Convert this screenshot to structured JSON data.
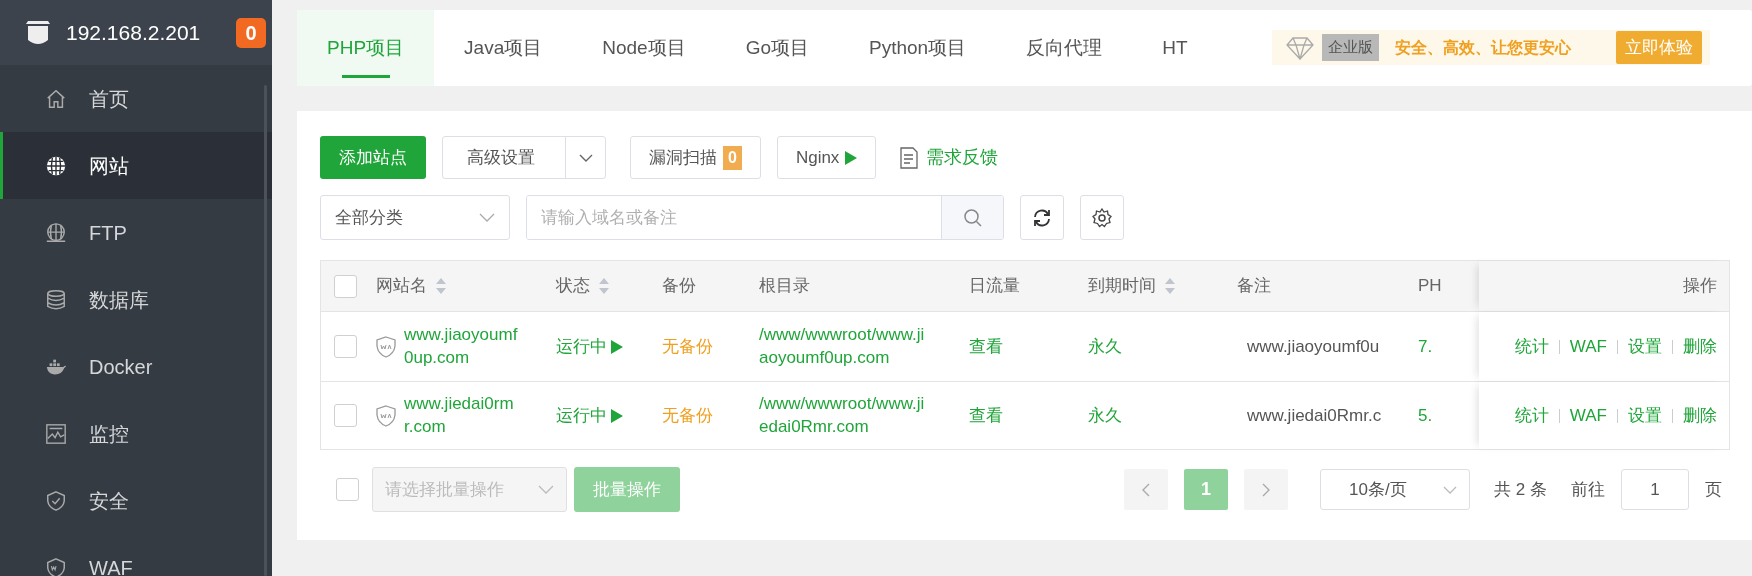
{
  "sidebar": {
    "host": "192.168.2.201",
    "badge": "0",
    "items": [
      {
        "label": "首页",
        "selected": false
      },
      {
        "label": "网站",
        "selected": true
      },
      {
        "label": "FTP",
        "selected": false
      },
      {
        "label": "数据库",
        "selected": false
      },
      {
        "label": "Docker",
        "selected": false
      },
      {
        "label": "监控",
        "selected": false
      },
      {
        "label": "安全",
        "selected": false
      },
      {
        "label": "WAF",
        "selected": false
      }
    ]
  },
  "tabs": [
    {
      "label": "PHP项目",
      "selected": true
    },
    {
      "label": "Java项目",
      "selected": false
    },
    {
      "label": "Node项目",
      "selected": false
    },
    {
      "label": "Go项目",
      "selected": false
    },
    {
      "label": "Python项目",
      "selected": false
    },
    {
      "label": "反向代理",
      "selected": false
    },
    {
      "label": "HT",
      "selected": false
    }
  ],
  "promo": {
    "edition": "企业版",
    "slogan": "安全、高效、让您更安心",
    "button": "立即体验"
  },
  "toolbar": {
    "add": "添加站点",
    "advanced": "高级设置",
    "scan": "漏洞扫描",
    "scan_count": "0",
    "nginx": "Nginx",
    "feedback": "需求反馈",
    "category": "全部分类",
    "search_placeholder": "请输入域名或备注"
  },
  "table": {
    "all_checked": false,
    "columns": [
      {
        "label": "网站名",
        "sortable": true
      },
      {
        "label": "状态",
        "sortable": true
      },
      {
        "label": "备份",
        "sortable": false
      },
      {
        "label": "根目录",
        "sortable": false
      },
      {
        "label": "日流量",
        "sortable": false
      },
      {
        "label": "到期时间",
        "sortable": true
      },
      {
        "label": "备注",
        "sortable": false
      },
      {
        "label": "PH",
        "sortable": false
      },
      {
        "label": "操作",
        "sortable": false
      }
    ],
    "rows": [
      {
        "checked": false,
        "name": "www.jiaoyoumf0up.com",
        "status": "运行中",
        "backup": "无备份",
        "root": "/www/wwwroot/www.jiaoyoumf0up.com",
        "traffic": "查看",
        "expiry": "永久",
        "remark": "www.jiaoyoumf0u",
        "php": "7.",
        "actions": [
          "统计",
          "WAF",
          "设置",
          "删除"
        ]
      },
      {
        "checked": false,
        "name": "www.jiedai0rmr.com",
        "status": "运行中",
        "backup": "无备份",
        "root": "/www/wwwroot/www.jiedai0Rmr.com",
        "traffic": "查看",
        "expiry": "永久",
        "remark": "www.jiedai0Rmr.c",
        "php": "5.",
        "actions": [
          "统计",
          "WAF",
          "设置",
          "删除"
        ]
      }
    ]
  },
  "footer": {
    "all_checked": false,
    "batch_placeholder": "请选择批量操作",
    "batch_button": "批量操作",
    "pages": [
      {
        "label": "1",
        "selected": true
      }
    ],
    "page_size": "10条/页",
    "total": "共 2 条",
    "goto_label": "前往",
    "goto_value": "1",
    "goto_suffix": "页"
  }
}
